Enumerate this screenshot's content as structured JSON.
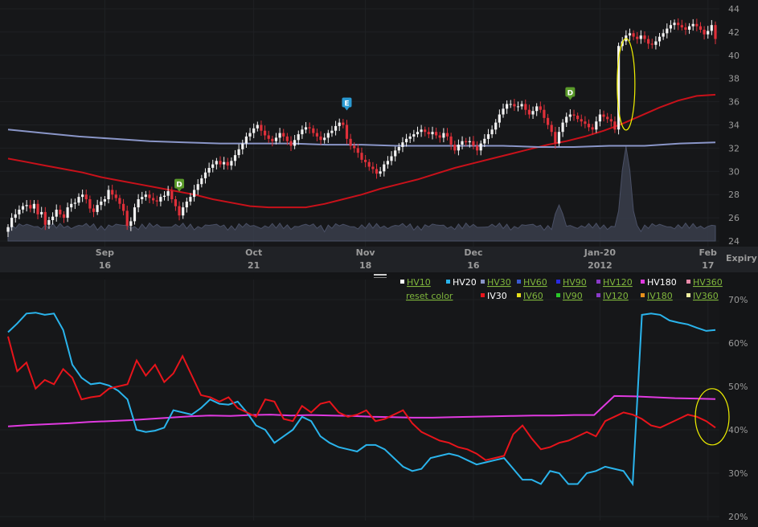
{
  "colors": {
    "background": "#141517",
    "candle_up": "#f2f2f2",
    "candle_down": "#e0303a",
    "ma_short": "#c8111a",
    "ma_long": "#8a96c8",
    "volume": "#3a3e4c",
    "hv20": "#2ab4ec",
    "iv30": "#e8141b",
    "hv180": "#e03ae0",
    "highlight": "#f0f000",
    "legend_link": "#7fb63c",
    "axis_text": "#9a9a9a"
  },
  "markers": [
    {
      "label": "D",
      "color": "#5a9a2a",
      "x_value": 46
    },
    {
      "label": "E",
      "color": "#2a9ad2",
      "x_value": 91
    },
    {
      "label": "D",
      "color": "#5a9a2a",
      "x_value": 151
    }
  ],
  "legend": {
    "row1": [
      {
        "label": "HV10",
        "swatch": "#ffffff",
        "link": true
      },
      {
        "label": "HV20",
        "swatch": "#2ab4ec",
        "link": false
      },
      {
        "label": "HV30",
        "swatch": "#8a96c8",
        "link": true
      },
      {
        "label": "HV60",
        "swatch": "#3a5ad0",
        "link": true
      },
      {
        "label": "HV90",
        "swatch": "#2a2ae0",
        "link": true
      },
      {
        "label": "HV120",
        "swatch": "#8a3ac8",
        "link": true
      },
      {
        "label": "HV180",
        "swatch": "#e03ae0",
        "link": false
      },
      {
        "label": "HV360",
        "swatch": "#e88aa8",
        "link": true
      }
    ],
    "row2": [
      {
        "label": "reset color",
        "swatch": "",
        "link": true
      },
      {
        "label": "IV30",
        "swatch": "#e8141b",
        "link": false
      },
      {
        "label": "IV60",
        "swatch": "#e8e01b",
        "link": true
      },
      {
        "label": "IV90",
        "swatch": "#2ac82a",
        "link": true
      },
      {
        "label": "IV120",
        "swatch": "#8a3ac8",
        "link": true
      },
      {
        "label": "IV180",
        "swatch": "#e8901b",
        "link": true
      },
      {
        "label": "IV360",
        "swatch": "#f0f0a0",
        "link": true
      }
    ]
  },
  "chart_data": [
    {
      "type": "candlestick",
      "title": "",
      "x_axis": {
        "ticks": [
          {
            "index": 26,
            "month": "Sep",
            "day": "16"
          },
          {
            "index": 66,
            "month": "Oct",
            "day": "21"
          },
          {
            "index": 96,
            "month": "Nov",
            "day": "18"
          },
          {
            "index": 125,
            "month": "Dec",
            "day": "16"
          },
          {
            "index": 159,
            "month": "Jan-20",
            "day": "2012"
          },
          {
            "index": 188,
            "month": "Feb",
            "day": "17"
          }
        ],
        "expiry_label": "Expiry"
      },
      "y_axis": {
        "min": 24,
        "max": 44,
        "ticks": [
          24,
          26,
          28,
          30,
          32,
          34,
          36,
          38,
          40,
          42,
          44
        ]
      },
      "close": [
        25.2,
        26.0,
        26.3,
        26.7,
        27.0,
        27.1,
        26.8,
        27.2,
        26.3,
        26.5,
        25.4,
        25.8,
        26.1,
        26.7,
        26.3,
        26.0,
        26.9,
        27.2,
        27.3,
        27.8,
        28.0,
        27.6,
        26.8,
        26.5,
        27.1,
        27.4,
        27.6,
        28.4,
        28.0,
        27.7,
        27.2,
        26.6,
        25.3,
        25.7,
        26.9,
        27.6,
        27.8,
        28.0,
        27.7,
        27.5,
        27.4,
        27.8,
        27.9,
        28.3,
        27.6,
        27.0,
        26.2,
        26.9,
        27.4,
        27.8,
        28.4,
        28.9,
        29.4,
        29.9,
        30.3,
        30.6,
        30.9,
        30.6,
        30.8,
        30.5,
        30.9,
        31.4,
        31.9,
        32.4,
        33.0,
        33.3,
        33.7,
        34.0,
        33.5,
        33.1,
        32.8,
        32.6,
        32.9,
        33.3,
        33.0,
        32.6,
        32.2,
        32.7,
        33.2,
        33.6,
        33.8,
        33.7,
        33.3,
        33.0,
        32.7,
        32.9,
        33.3,
        33.5,
        33.9,
        34.2,
        34.0,
        32.8,
        32.2,
        32.0,
        31.6,
        31.0,
        30.8,
        30.4,
        30.2,
        29.8,
        30.0,
        30.6,
        30.9,
        31.3,
        31.8,
        32.1,
        32.5,
        32.8,
        33.0,
        33.2,
        33.4,
        33.6,
        33.4,
        33.2,
        33.4,
        33.1,
        32.9,
        33.3,
        33.0,
        32.3,
        31.8,
        32.3,
        32.6,
        32.5,
        32.6,
        32.2,
        31.8,
        32.4,
        32.8,
        33.2,
        33.6,
        34.2,
        34.9,
        35.4,
        35.8,
        35.8,
        35.6,
        35.6,
        35.8,
        35.3,
        34.9,
        35.2,
        35.6,
        35.3,
        34.6,
        34.0,
        33.4,
        32.4,
        33.4,
        34.2,
        34.7,
        34.9,
        34.8,
        34.5,
        34.3,
        34.1,
        33.8,
        33.6,
        34.3,
        34.9,
        34.7,
        34.5,
        34.3,
        33.6,
        40.8,
        41.2,
        41.7,
        41.9,
        41.6,
        41.4,
        41.7,
        41.4,
        41.0,
        40.9,
        41.2,
        41.6,
        41.9,
        42.3,
        42.6,
        42.8,
        42.6,
        42.4,
        42.2,
        42.5,
        42.7,
        42.5,
        42.2,
        41.8,
        42.1,
        42.6,
        41.4
      ],
      "overlays": [
        {
          "name": "",
          "values": [
            31.1,
            30.8,
            30.5,
            30.2,
            29.9,
            29.5,
            29.2,
            28.9,
            28.6,
            28.3,
            28.0,
            27.6,
            27.3,
            27.0,
            26.9,
            26.9,
            26.9,
            27.2,
            27.6,
            28.0,
            28.5,
            28.9,
            29.3,
            29.8,
            30.3,
            30.7,
            31.1,
            31.5,
            31.9,
            32.3,
            32.6,
            33.0,
            33.5,
            34.1,
            34.8,
            35.5,
            36.1,
            36.5,
            36.6
          ]
        },
        {
          "name": "",
          "values": [
            33.6,
            33.3,
            33.0,
            32.8,
            32.6,
            32.5,
            32.4,
            32.4,
            32.4,
            32.3,
            32.3,
            32.2,
            32.2,
            32.2,
            32.2,
            32.1,
            32.1,
            32.2,
            32.2,
            32.4,
            32.5
          ]
        }
      ],
      "volume_spikes": [
        {
          "index": 148,
          "value": 3.2
        },
        {
          "index": 166,
          "value": 8.4
        }
      ],
      "annotation": {
        "shape": "ellipse",
        "around_index": 166
      }
    },
    {
      "type": "line",
      "title": "",
      "y_axis": {
        "min": 20,
        "max": 70,
        "ticks": [
          "20%",
          "30%",
          "40%",
          "50%",
          "60%",
          "70%"
        ]
      },
      "series": [
        {
          "name": "HV20",
          "values": [
            62.5,
            64.5,
            66.8,
            67.0,
            66.5,
            66.8,
            63.0,
            55.0,
            52.0,
            50.5,
            50.8,
            50.2,
            49.0,
            47.0,
            40.0,
            39.5,
            39.8,
            40.5,
            44.5,
            44.0,
            43.5,
            45.0,
            47.0,
            46.0,
            45.8,
            46.5,
            44.0,
            41.0,
            40.0,
            37.0,
            38.5,
            40.0,
            43.0,
            42.0,
            38.5,
            37.0,
            36.0,
            35.5,
            35.0,
            36.5,
            36.5,
            35.5,
            33.5,
            31.5,
            30.5,
            31.0,
            33.5,
            34.0,
            34.5,
            34.0,
            33.0,
            32.0,
            32.5,
            33.0,
            33.5,
            31.0,
            28.5,
            28.5,
            27.5,
            30.5,
            30.0,
            27.5,
            27.5,
            30.0,
            30.5,
            31.5,
            31.0,
            30.5,
            27.5,
            66.5,
            66.8,
            66.5,
            65.2,
            64.7,
            64.3,
            63.5,
            62.8,
            63.0
          ]
        },
        {
          "name": "IV30",
          "values": [
            61.5,
            53.5,
            55.5,
            49.5,
            51.5,
            50.5,
            54.0,
            52.0,
            47.0,
            47.5,
            47.8,
            49.5,
            50.0,
            50.5,
            56.0,
            52.5,
            55.0,
            51.0,
            53.0,
            57.0,
            52.5,
            48.0,
            47.5,
            46.5,
            47.5,
            45.0,
            44.0,
            43.0,
            47.0,
            46.5,
            42.5,
            42.0,
            45.5,
            44.0,
            46.0,
            46.5,
            44.0,
            43.0,
            43.5,
            44.5,
            42.0,
            42.5,
            43.5,
            44.5,
            41.5,
            39.5,
            38.5,
            37.5,
            37.0,
            36.0,
            35.5,
            34.5,
            33.0,
            33.5,
            34.0,
            39.0,
            41.0,
            38.0,
            35.5,
            36.0,
            37.0,
            37.5,
            38.5,
            39.5,
            38.5,
            42.0,
            43.0,
            44.0,
            43.5,
            42.5,
            41.0,
            40.5,
            41.5,
            42.5,
            43.5,
            43.0,
            42.0,
            40.5
          ]
        },
        {
          "name": "HV180",
          "values": [
            40.8,
            41.1,
            41.3,
            41.5,
            41.8,
            42.0,
            42.2,
            42.5,
            42.8,
            43.1,
            43.3,
            43.2,
            43.4,
            43.5,
            43.3,
            43.4,
            43.3,
            43.2,
            43.0,
            42.9,
            42.8,
            42.8,
            42.9,
            43.0,
            43.1,
            43.2,
            43.3,
            43.3,
            43.4,
            43.4,
            47.8,
            47.7,
            47.5,
            47.3,
            47.2,
            47.1
          ]
        }
      ],
      "annotation": {
        "shape": "ellipse",
        "around": "last values"
      }
    }
  ]
}
